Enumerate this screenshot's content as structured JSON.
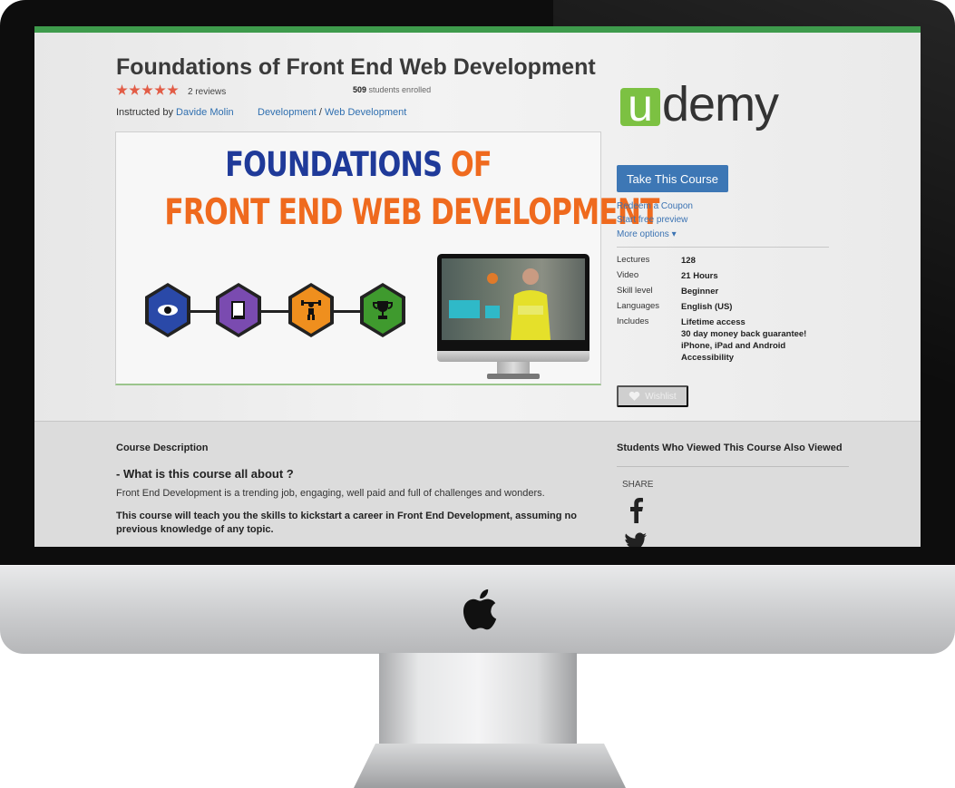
{
  "course": {
    "title": "Foundations of Front End Web Development",
    "rating_stars": 5,
    "reviews": "2 reviews",
    "enrolled_count": "509",
    "enrolled_label": " students enrolled",
    "instructed_prefix": "Instructed by ",
    "instructor": "Davide Molin",
    "category": "Development",
    "category_sep": " / ",
    "subcategory": "Web Development"
  },
  "promo": {
    "line1_a": "FOUNDATIONS",
    "line1_b": " OF",
    "line2": "FRONT END WEB DEVELOPMENT",
    "icons": [
      "eye-icon",
      "book-icon",
      "weightlifter-icon",
      "trophy-icon"
    ],
    "icon_colors": [
      "#2a49a8",
      "#7a4bb0",
      "#ef8f1e",
      "#3f9a2e"
    ]
  },
  "brand": {
    "logo_u": "u",
    "logo_rest": "demy",
    "accent": "#7cc142"
  },
  "sidebar": {
    "take_course": "Take This Course",
    "redeem": "Redeem a Coupon",
    "preview": "Start free preview",
    "more": "More options ▾",
    "specs": [
      {
        "label": "Lectures",
        "value": "128"
      },
      {
        "label": "Video",
        "value": "21 Hours"
      },
      {
        "label": "Skill level",
        "value": "Beginner"
      },
      {
        "label": "Languages",
        "value": "English (US)"
      },
      {
        "label": "Includes",
        "value": "Lifetime access"
      }
    ],
    "includes_more": [
      "30 day money back guarantee!",
      "iPhone, iPad and Android",
      "Accessibility"
    ],
    "wishlist": "Wishlist"
  },
  "description": {
    "heading": "Course Description",
    "question": "- What is this course all about ?",
    "para": "Front End Development is a trending job, engaging, well paid and full of challenges and wonders.",
    "bold": "This course will teach you the skills to kickstart a career in Front End Development, assuming no previous knowledge of any topic."
  },
  "also_viewed": {
    "heading": "Students Who Viewed This Course Also Viewed",
    "share": "SHARE"
  },
  "colors": {
    "top_bar": "#3e9b4c",
    "button": "#3d77b5",
    "link": "#2f6fb0",
    "star": "#e25c46"
  }
}
